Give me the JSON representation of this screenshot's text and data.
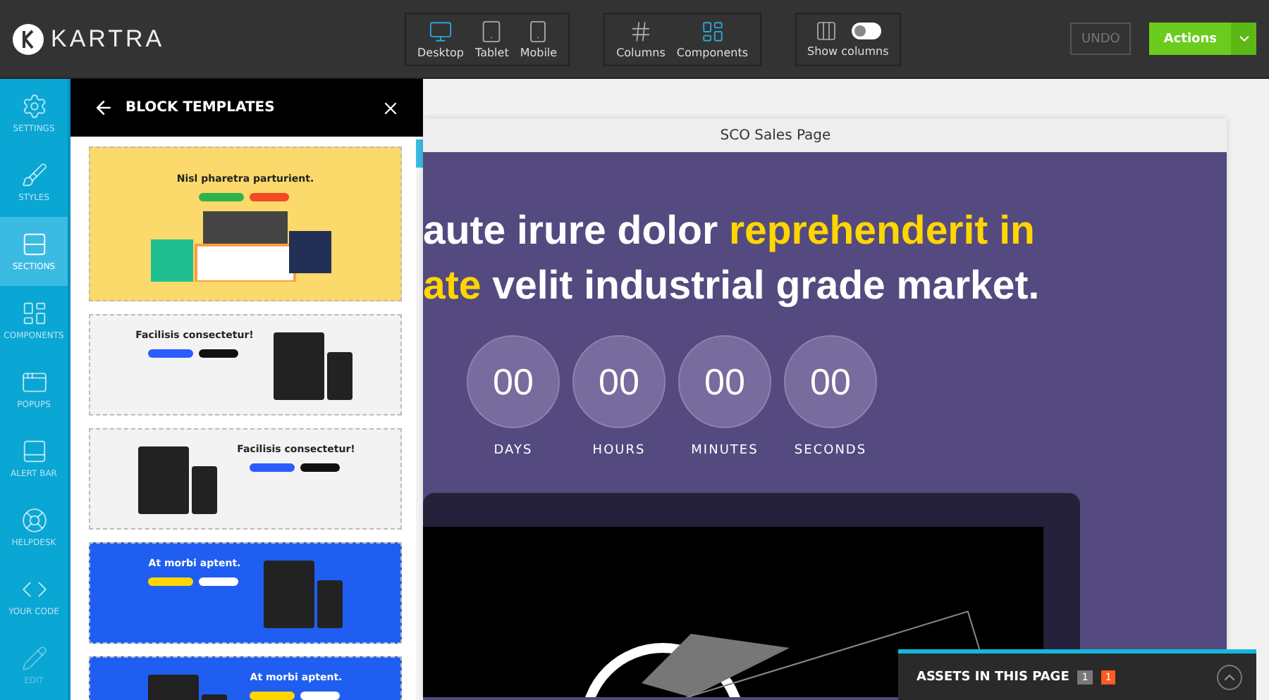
{
  "app": {
    "logo": "KARTRA"
  },
  "toolbar": {
    "view_modes": [
      {
        "label": "Desktop",
        "selected": true
      },
      {
        "label": "Tablet",
        "selected": false
      },
      {
        "label": "Mobile",
        "selected": false
      }
    ],
    "layout_tools": [
      {
        "label": "Columns",
        "selected": false
      },
      {
        "label": "Components",
        "selected": true
      }
    ],
    "show_columns": {
      "label": "Show columns",
      "on": false
    },
    "undo": {
      "label": "UNDO",
      "disabled": true
    },
    "actions": {
      "label": "Actions"
    }
  },
  "sidebar": {
    "items": [
      {
        "label": "SETTINGS",
        "selected": false,
        "disabled": false
      },
      {
        "label": "STYLES",
        "selected": false,
        "disabled": false
      },
      {
        "label": "SECTIONS",
        "selected": true,
        "disabled": false
      },
      {
        "label": "COMPONENTS",
        "selected": false,
        "disabled": false
      },
      {
        "label": "POPUPS",
        "selected": false,
        "disabled": false
      },
      {
        "label": "ALERT BAR",
        "selected": false,
        "disabled": false
      },
      {
        "label": "HELPDESK",
        "selected": false,
        "disabled": false
      },
      {
        "label": "YOUR CODE",
        "selected": false,
        "disabled": false
      },
      {
        "label": "EDIT",
        "selected": false,
        "disabled": true
      }
    ]
  },
  "panel": {
    "title": "BLOCK TEMPLATES",
    "templates": [
      {
        "heading": "Nisl pharetra parturient.",
        "color": "#fbd96a",
        "kind": "showcase"
      },
      {
        "heading": "Facilisis consectetur!",
        "color": "#f3f3f3",
        "kind": "rightdevice"
      },
      {
        "heading": "Facilisis consectetur!",
        "color": "#f3f3f3",
        "kind": "leftdevice"
      },
      {
        "heading": "At morbi aptent.",
        "color": "#1f5ef0",
        "kind": "rightdevice"
      },
      {
        "heading": "At morbi aptent.",
        "color": "#1f5ef0",
        "kind": "leftdevice"
      }
    ]
  },
  "canvas": {
    "page_title": "SCO Sales Page",
    "headline": [
      [
        {
          "text": "aute irure dolor ",
          "highlight": false
        },
        {
          "text": "reprehenderit in",
          "highlight": true
        }
      ],
      [
        {
          "text": "ate",
          "highlight": true
        },
        {
          "text": " velit industrial grade market.",
          "highlight": false
        }
      ]
    ],
    "countdown": [
      {
        "value": "00",
        "label": "DAYS"
      },
      {
        "value": "00",
        "label": "HOURS"
      },
      {
        "value": "00",
        "label": "MINUTES"
      },
      {
        "value": "00",
        "label": "SECONDS"
      }
    ]
  },
  "assets": {
    "title": "ASSETS IN THIS PAGE",
    "counts": [
      {
        "value": "1",
        "kind": "neutral"
      },
      {
        "value": "1",
        "kind": "alert"
      }
    ]
  }
}
